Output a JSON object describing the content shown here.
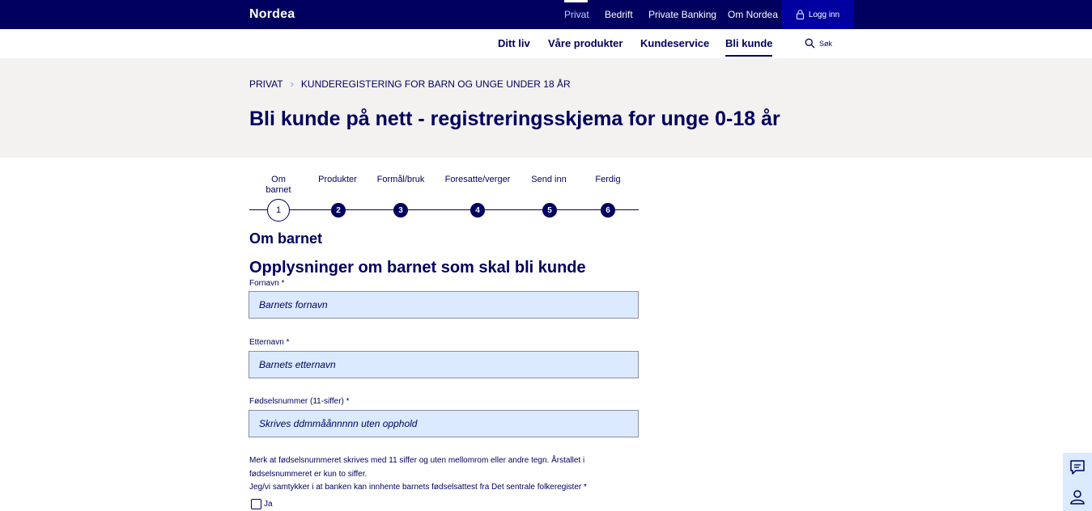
{
  "brand": {
    "logo": "Nordea"
  },
  "topnav": {
    "items": [
      "Privat",
      "Bedrift",
      "Private Banking",
      "Om Nordea"
    ],
    "login": "Logg inn"
  },
  "secnav": {
    "items": [
      "Ditt liv",
      "Våre produkter",
      "Kundeservice",
      "Bli kunde"
    ],
    "search": "Søk"
  },
  "breadcrumb": {
    "home": "PRIVAT",
    "current": "KUNDEREGISTERING FOR BARN OG UNGE UNDER 18 ÅR"
  },
  "page_title": "Bli kunde på nett - registreringsskjema for unge 0-18 år",
  "stepper": {
    "steps": [
      {
        "label_line1": "Om",
        "label_line2": "barnet",
        "number": "1"
      },
      {
        "label_line1": "Produkter",
        "label_line2": "",
        "number": "2"
      },
      {
        "label_line1": "Formål/bruk",
        "label_line2": "",
        "number": "3"
      },
      {
        "label_line1": "Foresatte/verger",
        "label_line2": "",
        "number": "4"
      },
      {
        "label_line1": "Send inn",
        "label_line2": "",
        "number": "5"
      },
      {
        "label_line1": "Ferdig",
        "label_line2": "",
        "number": "6"
      }
    ]
  },
  "form": {
    "section_title": "Om barnet",
    "subsection_title": "Opplysninger om barnet som skal bli kunde",
    "fields": [
      {
        "label": "Fornavn",
        "required": "*",
        "value": "",
        "placeholder": "Barnets fornavn"
      },
      {
        "label": "Etternavn",
        "required": "*",
        "value": "",
        "placeholder": "Barnets etternavn"
      },
      {
        "label": "Fødselsnummer (11-siffer)",
        "required": "*",
        "value": "",
        "placeholder": "Skrives ddmmåånnnnn uten opphold"
      }
    ],
    "note_line1": "Merk at fødselsnummeret skrives med 11 siffer og uten mellomrom eller andre tegn. Årstallet i",
    "note_line2": "fødselsnummeret er kun to siffer.",
    "consent_label": "Jeg/vi samtykker i at banken kan innhente barnets fødselsattest fra Det sentrale folkeregister",
    "consent_required": "*",
    "consent_option": "Ja"
  },
  "side_buttons": [
    "chat-icon",
    "contact-person-icon"
  ],
  "colors": {
    "navy": "#00005e",
    "login_bg": "#0000a0",
    "field_bg": "#dbeaff",
    "hero_bg": "#f3f2f1"
  }
}
